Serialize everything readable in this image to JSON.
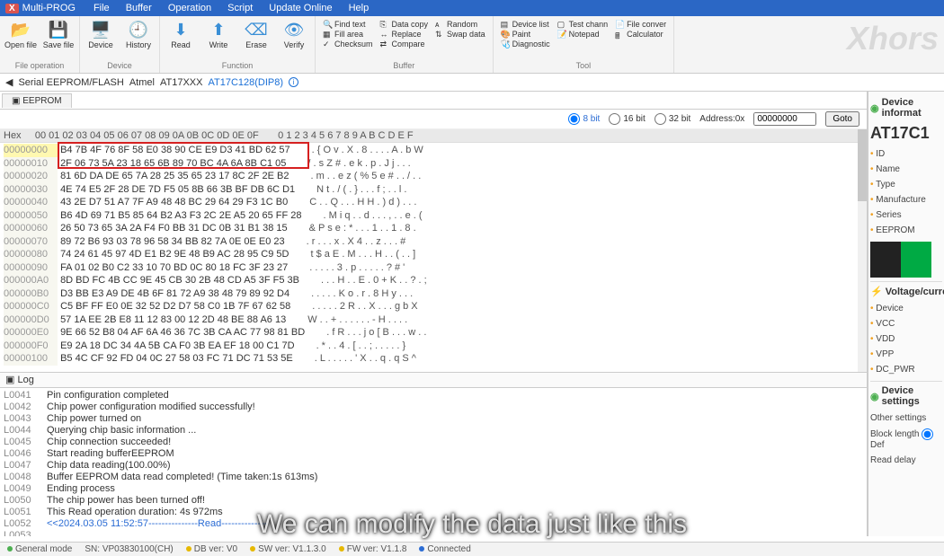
{
  "title": {
    "app": "Multi-PROG"
  },
  "menus": [
    "File",
    "Buffer",
    "Operation",
    "Script",
    "Update Online",
    "Help"
  ],
  "ribbon": {
    "file": {
      "label": "File operation",
      "open": "Open file",
      "save": "Save file"
    },
    "device": {
      "label": "Device",
      "device": "Device",
      "history": "History"
    },
    "func": {
      "label": "Function",
      "read": "Read",
      "write": "Write",
      "erase": "Erase",
      "verify": "Verify"
    },
    "buffer": {
      "label": "Buffer",
      "items1": [
        "Find text",
        "Fill area",
        "Checksum"
      ],
      "items2": [
        "Data copy",
        "Replace",
        "Compare"
      ],
      "items3": [
        "Random",
        "Swap data"
      ]
    },
    "tool": {
      "label": "Tool",
      "items1": [
        "Device list",
        "Paint",
        "Diagnostic"
      ],
      "items2": [
        "Test chann",
        "Notepad"
      ],
      "items3": [
        "File conver",
        "Calculator"
      ]
    }
  },
  "watermark": "Xhors",
  "crumb": {
    "a": "Serial EEPROM/FLASH",
    "b": "Atmel",
    "c": "AT17XXX",
    "d": "AT17C128(DIP8)"
  },
  "hex": {
    "tab": "EEPROM",
    "bits": {
      "b8": "8 bit",
      "b16": "16 bit",
      "b32": "32 bit"
    },
    "addr_label": "Address:0x",
    "addr_value": "00000000",
    "goto": "Goto",
    "header": "Hex     00 01 02 03 04 05 06 07 08 09 0A 0B 0C 0D 0E 0F       0 1 2 3 4 5 6 7 8 9 A B C D E F",
    "rows": [
      {
        "addr": "00000000",
        "bytes": "B4 7B 4F 76 8F 58 E0 38 90 CE E9 D3 41 BD 62 57",
        "ascii": ". { O v . X . 8 . . . . A . b W"
      },
      {
        "addr": "00000010",
        "bytes": "2F 06 73 5A 23 18 65 6B 89 70 BC 4A 6A 8B C1 05",
        "ascii": "/ . s Z # . e k . p . J j . . ."
      },
      {
        "addr": "00000020",
        "bytes": "81 6D DA DE 65 7A 28 25 35 65 23 17 8C 2F 2E B2",
        "ascii": ". m . . e z ( % 5 e # . . / . ."
      },
      {
        "addr": "00000030",
        "bytes": "4E 74 E5 2F 28 DE 7D F5 05 8B 66 3B BF DB 6C D1",
        "ascii": "N t . / ( . } . . . f ; . . l ."
      },
      {
        "addr": "00000040",
        "bytes": "43 2E D7 51 A7 7F A9 48 48 BC 29 64 29 F3 1C B0",
        "ascii": "C . . Q . . . H H . ) d ) . . ."
      },
      {
        "addr": "00000050",
        "bytes": "B6 4D 69 71 B5 85 64 B2 A3 F3 2C 2E A5 20 65 FF 28",
        "ascii": ". M i q . . d . . . , . . e . ("
      },
      {
        "addr": "00000060",
        "bytes": "26 50 73 65 3A 2A F4 F0 BB 31 DC 0B 31 B1 38 15",
        "ascii": "& P s e : * . . . 1 . . 1 . 8 ."
      },
      {
        "addr": "00000070",
        "bytes": "89 72 B6 93 03 78 96 58 34 BB 82 7A 0E 0E E0 23",
        "ascii": ". r . . . x . X 4 . . z . . . #"
      },
      {
        "addr": "00000080",
        "bytes": "74 24 61 45 97 4D E1 B2 9E 48 B9 AC 28 95 C9 5D",
        "ascii": "t $ a E . M . . . H . . ( . . ]"
      },
      {
        "addr": "00000090",
        "bytes": "FA 01 02 B0 C2 33 10 70 BD 0C 80 18 FC 3F 23 27",
        "ascii": ". . . . . 3 . p . . . . . ? # '"
      },
      {
        "addr": "000000A0",
        "bytes": "8D BD FC 4B CC 9E 45 CB 30 2B 48 CD A5 3F F5 3B",
        "ascii": ". . . H . . E . 0 + K . . ? . ;"
      },
      {
        "addr": "000000B0",
        "bytes": "D3 BB E3 A9 DE 4B 6F 81 72 A9 38 48 79 89 92 D4",
        "ascii": ". . . . . K o . r . 8 H y . . ."
      },
      {
        "addr": "000000C0",
        "bytes": "C5 BF FF E0 0E 32 52 D2 D7 58 C0 1B 7F 67 62 58",
        "ascii": ". . . . . 2 R . . X . . . g b X"
      },
      {
        "addr": "000000D0",
        "bytes": "57 1A EE 2B E8 11 12 83 00 12 2D 48 BE 88 A6 13",
        "ascii": "W . . + . . . . . . - H . . . ."
      },
      {
        "addr": "000000E0",
        "bytes": "9E 66 52 B8 04 AF 6A 46 36 7C 3B CA AC 77 98 81 BD",
        "ascii": ". f R . . . j o [ B . . . w . ."
      },
      {
        "addr": "000000F0",
        "bytes": "E9 2A 18 DC 34 4A 5B CA F0 3B EA EF 18 00 C1 7D",
        "ascii": ". * . . 4 . [ . . ; . . . . . }"
      },
      {
        "addr": "00000100",
        "bytes": "B5 4C CF 92 FD 04 0C 27 58 03 FC 71 DC 71 53 5E",
        "ascii": ". L . . . . . ' X . . q . q S ^"
      }
    ]
  },
  "log": {
    "title": "Log",
    "rows": [
      {
        "n": "L0041",
        "t": "Pin configuration completed"
      },
      {
        "n": "L0042",
        "t": "Chip power configuration modified successfully!"
      },
      {
        "n": "L0043",
        "t": "Chip power turned on"
      },
      {
        "n": "L0044",
        "t": "Querying chip basic information ..."
      },
      {
        "n": "L0045",
        "t": "Chip connection succeeded!"
      },
      {
        "n": "L0046",
        "t": "Start reading bufferEEPROM"
      },
      {
        "n": "L0047",
        "t": "Chip data reading(100.00%)"
      },
      {
        "n": "L0048",
        "t": "Buffer EEPROM data read completed! (Time taken:1s 613ms)"
      },
      {
        "n": "L0049",
        "t": "Ending process"
      },
      {
        "n": "L0050",
        "t": "The chip power has been turned off!"
      },
      {
        "n": "L0051",
        "t": "This Read operation duration: 4s 972ms"
      },
      {
        "n": "L0052",
        "t": "<<2024.03.05 11:52:57---------------Read--------------",
        "blue": true
      },
      {
        "n": "L0053",
        "t": ""
      }
    ]
  },
  "rpanel": {
    "title1": "Device informat",
    "chip": "AT17C1",
    "fields": [
      "ID",
      "Name",
      "Type",
      "Manufacture",
      "Series",
      "EEPROM"
    ],
    "title2": "Voltage/current",
    "fields2": [
      "Device",
      "VCC",
      "VDD",
      "VPP",
      "DC_PWR"
    ],
    "title3": "Device settings",
    "other": "Other settings",
    "blklen": "Block length",
    "blkdef": "Def",
    "rdelay": "Read delay"
  },
  "status": {
    "mode": "General mode",
    "sn": "SN:  VP03830100(CH)",
    "db": "DB ver: V0",
    "sw": "SW ver: V1.1.3.0",
    "fw": "FW ver: V1.1.8",
    "conn": "Connected"
  },
  "caption": "We can modify the data just like this"
}
